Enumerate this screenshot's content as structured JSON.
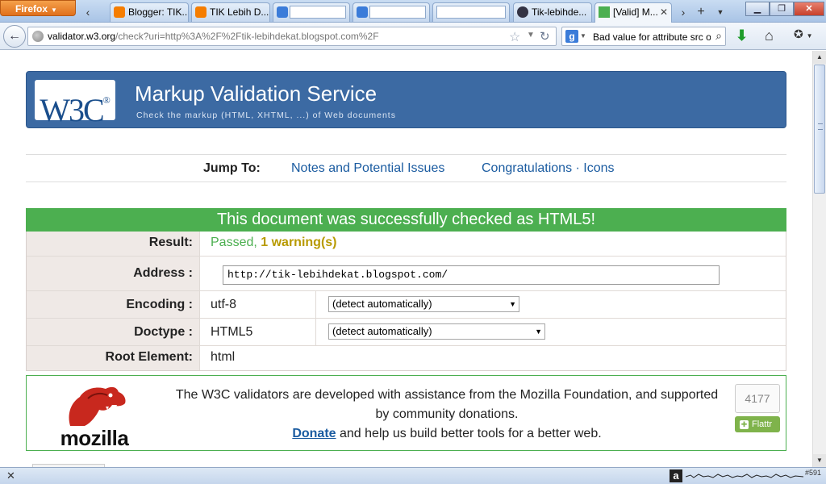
{
  "browser": {
    "menu_button": "Firefox",
    "tabs": [
      {
        "label": "Blogger: TIK...",
        "icon": "blogger-icon",
        "color": "#f57d00"
      },
      {
        "label": "TIK Lebih D...",
        "icon": "blogger-icon",
        "color": "#f57d00"
      },
      {
        "label": "",
        "icon": "google-icon",
        "color": "#3b7cd9"
      },
      {
        "label": "",
        "icon": "google-icon",
        "color": "#3b7cd9"
      },
      {
        "label": "",
        "icon": "blank-icon",
        "color": "#ffffff"
      },
      {
        "label": "Tik-lebihde...",
        "icon": "site-icon",
        "color": "#335"
      },
      {
        "label": "[Valid] M...",
        "icon": "w3c-valid-icon",
        "color": "#4caf50"
      }
    ],
    "url_host": "validator.w3.org",
    "url_path": "/check?uri=http%3A%2F%2Ftik-lebihdekat.blogspot.com%2F",
    "search_text": "Bad value for attribute src o"
  },
  "page": {
    "banner_title": "Markup Validation Service",
    "banner_subtitle": "Check the markup (HTML, XHTML, ...) of Web documents",
    "logo_text": "W3C",
    "jump_label": "Jump To:",
    "jump_links": [
      "Notes and Potential Issues",
      "Congratulations · Icons"
    ],
    "result_heading": "This document was successfully checked as HTML5!",
    "rows": {
      "result_label": "Result:",
      "result_passed": "Passed,",
      "result_warnings": "1 warning(s)",
      "address_label": "Address :",
      "address_value": "http://tik-lebihdekat.blogspot.com/",
      "encoding_label": "Encoding :",
      "encoding_value": "utf-8",
      "encoding_select": "(detect automatically)",
      "doctype_label": "Doctype :",
      "doctype_value": "HTML5",
      "doctype_select": "(detect automatically)",
      "root_label": "Root Element:",
      "root_value": "html"
    },
    "mozilla": {
      "wordmark": "mozilla",
      "text_line": "The W3C validators are developed with assistance from the Mozilla Foundation, and supported by community donations.",
      "donate_link": "Donate",
      "donate_rest": " and help us build better tools for a better web.",
      "flattr_count": "4177",
      "flattr_label": "Flattr"
    }
  },
  "addon_bar": {
    "count": "#591"
  },
  "colors": {
    "banner": "#3c6aa3",
    "success": "#4caf50",
    "warning": "#b89a00",
    "link": "#1a5ba0"
  }
}
